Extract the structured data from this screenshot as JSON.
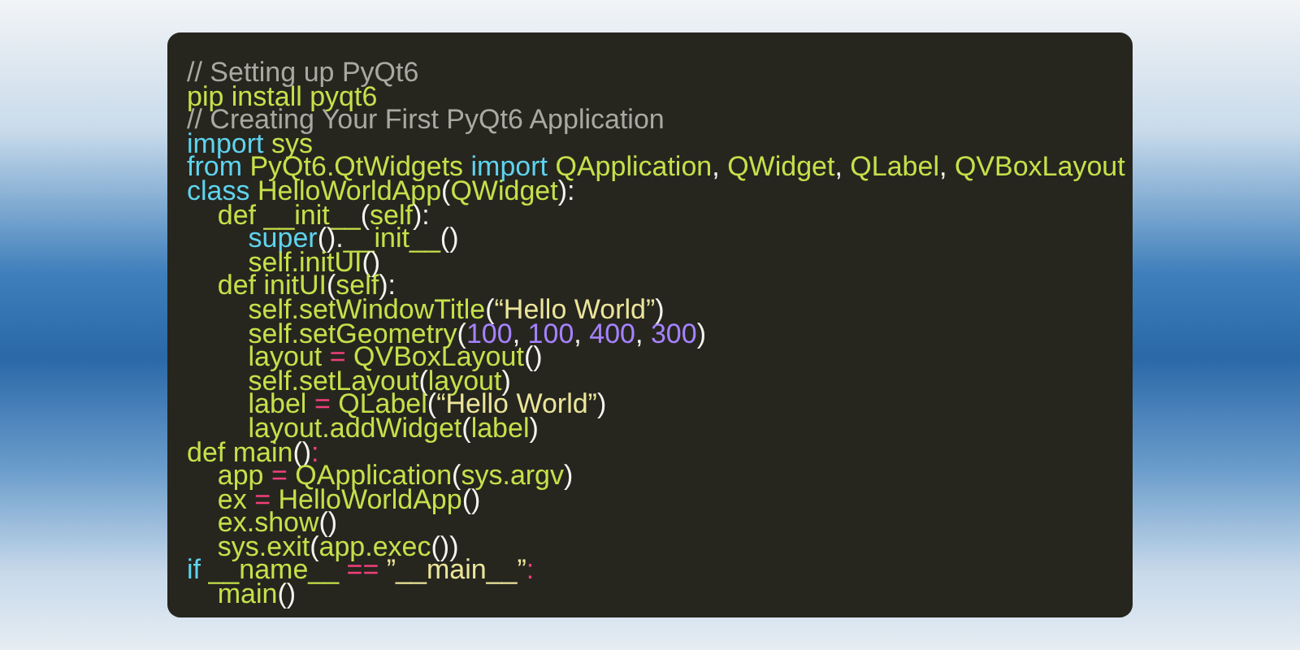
{
  "code": {
    "lines": [
      [
        {
          "kind": "comment",
          "text": "// Setting up PyQt6"
        }
      ],
      [
        {
          "kind": "name",
          "text": "pip install pyqt6"
        }
      ],
      [
        {
          "kind": "comment",
          "text": "// Creating Your First PyQt6 Application"
        }
      ],
      [
        {
          "kind": "keyword",
          "text": "import"
        },
        {
          "kind": "name",
          "text": " sys"
        }
      ],
      [
        {
          "kind": "keyword",
          "text": "from"
        },
        {
          "kind": "name",
          "text": " PyQt6.QtWidgets "
        },
        {
          "kind": "keyword",
          "text": "import"
        },
        {
          "kind": "name",
          "text": " QApplication"
        },
        {
          "kind": "punct",
          "text": ", "
        },
        {
          "kind": "name",
          "text": "QWidget"
        },
        {
          "kind": "punct",
          "text": ", "
        },
        {
          "kind": "name",
          "text": "QLabel"
        },
        {
          "kind": "punct",
          "text": ", "
        },
        {
          "kind": "name",
          "text": "QVBoxLayout"
        }
      ],
      [
        {
          "kind": "keyword",
          "text": "class"
        },
        {
          "kind": "name",
          "text": " HelloWorldApp"
        },
        {
          "kind": "punct",
          "text": "("
        },
        {
          "kind": "name",
          "text": "QWidget"
        },
        {
          "kind": "punct",
          "text": "):"
        }
      ],
      [
        {
          "kind": "name",
          "text": "    def __init__"
        },
        {
          "kind": "punct",
          "text": "("
        },
        {
          "kind": "name",
          "text": "self"
        },
        {
          "kind": "punct",
          "text": "):"
        }
      ],
      [
        {
          "kind": "keyword",
          "text": "        super"
        },
        {
          "kind": "punct",
          "text": "()."
        },
        {
          "kind": "name",
          "text": "__init__"
        },
        {
          "kind": "punct",
          "text": "()"
        }
      ],
      [
        {
          "kind": "name",
          "text": "        self.initUI"
        },
        {
          "kind": "punct",
          "text": "()"
        }
      ],
      [
        {
          "kind": "name",
          "text": "    def initUI"
        },
        {
          "kind": "punct",
          "text": "("
        },
        {
          "kind": "name",
          "text": "self"
        },
        {
          "kind": "punct",
          "text": "):"
        }
      ],
      [
        {
          "kind": "name",
          "text": "        self.setWindowTitle"
        },
        {
          "kind": "punct",
          "text": "("
        },
        {
          "kind": "string",
          "text": "“Hello World”"
        },
        {
          "kind": "punct",
          "text": ")"
        }
      ],
      [
        {
          "kind": "name",
          "text": "        self.setGeometry"
        },
        {
          "kind": "punct",
          "text": "("
        },
        {
          "kind": "number",
          "text": "100"
        },
        {
          "kind": "punct",
          "text": ", "
        },
        {
          "kind": "number",
          "text": "100"
        },
        {
          "kind": "punct",
          "text": ", "
        },
        {
          "kind": "number",
          "text": "400"
        },
        {
          "kind": "punct",
          "text": ", "
        },
        {
          "kind": "number",
          "text": "300"
        },
        {
          "kind": "punct",
          "text": ")"
        }
      ],
      [
        {
          "kind": "name",
          "text": "        layout "
        },
        {
          "kind": "operator",
          "text": "="
        },
        {
          "kind": "name",
          "text": " QVBoxLayout"
        },
        {
          "kind": "punct",
          "text": "()"
        }
      ],
      [
        {
          "kind": "name",
          "text": "        self.setLayout"
        },
        {
          "kind": "punct",
          "text": "("
        },
        {
          "kind": "name",
          "text": "layout"
        },
        {
          "kind": "punct",
          "text": ")"
        }
      ],
      [
        {
          "kind": "name",
          "text": "        label "
        },
        {
          "kind": "operator",
          "text": "="
        },
        {
          "kind": "name",
          "text": " QLabel"
        },
        {
          "kind": "punct",
          "text": "("
        },
        {
          "kind": "string",
          "text": "“Hello World”"
        },
        {
          "kind": "punct",
          "text": ")"
        }
      ],
      [
        {
          "kind": "name",
          "text": "        layout.addWidget"
        },
        {
          "kind": "punct",
          "text": "("
        },
        {
          "kind": "name",
          "text": "label"
        },
        {
          "kind": "punct",
          "text": ")"
        }
      ],
      [
        {
          "kind": "name",
          "text": "def main"
        },
        {
          "kind": "punct",
          "text": "()"
        },
        {
          "kind": "operator",
          "text": ":"
        }
      ],
      [
        {
          "kind": "name",
          "text": "    app "
        },
        {
          "kind": "operator",
          "text": "="
        },
        {
          "kind": "name",
          "text": " QApplication"
        },
        {
          "kind": "punct",
          "text": "("
        },
        {
          "kind": "name",
          "text": "sys.argv"
        },
        {
          "kind": "punct",
          "text": ")"
        }
      ],
      [
        {
          "kind": "name",
          "text": "    ex "
        },
        {
          "kind": "operator",
          "text": "="
        },
        {
          "kind": "name",
          "text": " HelloWorldApp"
        },
        {
          "kind": "punct",
          "text": "()"
        }
      ],
      [
        {
          "kind": "name",
          "text": "    ex.show"
        },
        {
          "kind": "punct",
          "text": "()"
        }
      ],
      [
        {
          "kind": "name",
          "text": "    sys.exit"
        },
        {
          "kind": "punct",
          "text": "("
        },
        {
          "kind": "name",
          "text": "app.exec"
        },
        {
          "kind": "punct",
          "text": "())"
        }
      ],
      [
        {
          "kind": "keyword",
          "text": "if"
        },
        {
          "kind": "name",
          "text": " __name__ "
        },
        {
          "kind": "operator",
          "text": "=="
        },
        {
          "kind": "string",
          "text": " ”__main__”"
        },
        {
          "kind": "operator",
          "text": ":"
        }
      ],
      [
        {
          "kind": "name",
          "text": "    main"
        },
        {
          "kind": "punct",
          "text": "()"
        }
      ]
    ]
  }
}
